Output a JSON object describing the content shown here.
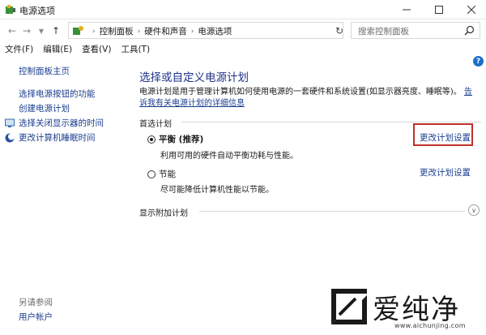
{
  "window": {
    "title": "电源选项"
  },
  "address": {
    "crumbs": [
      "控制面板",
      "硬件和声音",
      "电源选项"
    ],
    "search_placeholder": "搜索控制面板"
  },
  "menu": {
    "items": [
      "文件(F)",
      "编辑(E)",
      "查看(V)",
      "工具(T)"
    ]
  },
  "sidebar": {
    "home": "控制面板主页",
    "links": [
      "选择电源按钮的功能",
      "创建电源计划",
      "选择关闭显示器的时间",
      "更改计算机睡眠时间"
    ],
    "see_also": "另请参阅",
    "user_accounts": "用户帐户"
  },
  "main": {
    "title": "选择或自定义电源计划",
    "desc": "电源计划是用于管理计算机如何使用电源的一套硬件和系统设置(如显示器亮度、睡眠等)。",
    "desc_link": "告诉我有关电源计划的详细信息",
    "preferred_label": "首选计划",
    "plans": [
      {
        "name": "平衡 (推荐)",
        "desc": "利用可用的硬件自动平衡功耗与性能。",
        "selected": true,
        "change": "更改计划设置"
      },
      {
        "name": "节能",
        "desc": "尽可能降低计算机性能以节能。",
        "selected": false,
        "change": "更改计划设置"
      }
    ],
    "extra_label": "显示附加计划"
  },
  "watermark": {
    "brand": "爱纯净",
    "url": "www.aichunjing.com"
  },
  "colors": {
    "link": "#1a3d8f",
    "title": "#1e3287",
    "highlight_box": "#c0302b"
  },
  "icons": {
    "help": "?"
  }
}
